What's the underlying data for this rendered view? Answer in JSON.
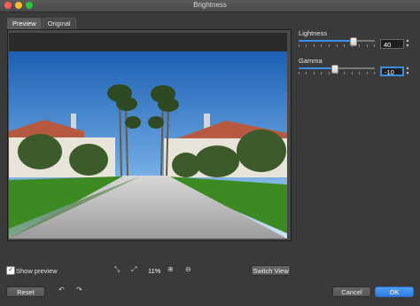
{
  "window": {
    "title": "Brightness"
  },
  "tabs": [
    {
      "label": "Preview",
      "active": true
    },
    {
      "label": "Original",
      "active": false
    }
  ],
  "sliders": {
    "lightness": {
      "label": "Lightness",
      "value": "40"
    },
    "gamma": {
      "label": "Gamma",
      "value": "-10"
    }
  },
  "footer": {
    "show_preview_label": "Show preview",
    "show_preview_checked": true,
    "zoom": "11%",
    "switch_view_label": "Switch View",
    "reset_label": "Reset",
    "cancel_label": "Cancel",
    "ok_label": "OK"
  },
  "colors": {
    "accent": "#3c8ee6",
    "background": "#3a3a3a"
  }
}
